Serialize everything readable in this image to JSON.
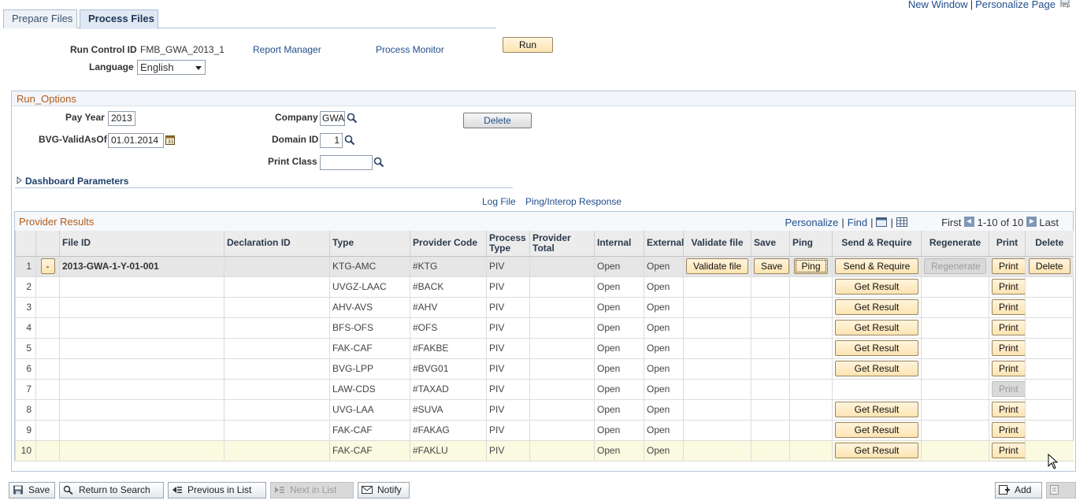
{
  "top_links": {
    "new_window": "New Window",
    "personalize_page": "Personalize Page",
    "separator": "|"
  },
  "tabs": [
    {
      "label": "Prepare Files",
      "active": false
    },
    {
      "label": "Process Files",
      "active": true
    }
  ],
  "header": {
    "run_control_label": "Run Control ID",
    "run_control_value": "FMB_GWA_2013_1",
    "report_manager": "Report Manager",
    "process_monitor": "Process Monitor",
    "run_button": "Run",
    "language_label": "Language",
    "language_value": "English"
  },
  "run_options": {
    "title": "Run_Options",
    "pay_year_label": "Pay Year",
    "pay_year_value": "2013",
    "company_label": "Company",
    "company_value": "GWA",
    "delete_button": "Delete",
    "bvg_label": "BVG-ValidAsOf",
    "bvg_value": "01.01.2014",
    "domain_label": "Domain ID",
    "domain_value": "1",
    "print_class_label": "Print Class",
    "print_class_value": "",
    "dashboard_parameters": "Dashboard Parameters"
  },
  "links": {
    "log_file": "Log File",
    "ping_response": "Ping/Interop Response"
  },
  "grid": {
    "title": "Provider Results",
    "personalize": "Personalize",
    "find": "Find",
    "first": "First",
    "range": "1-10 of 10",
    "last": "Last",
    "columns": {
      "file_id": "File ID",
      "declaration_id": "Declaration ID",
      "type": "Type",
      "provider_code": "Provider Code",
      "process_type_1": "Process",
      "process_type_2": "Type",
      "provider_total_1": "Provider",
      "provider_total_2": "Total",
      "internal": "Internal",
      "external": "External",
      "validate_file": "Validate file",
      "save": "Save",
      "ping": "Ping",
      "send_require": "Send & Require",
      "regenerate": "Regenerate",
      "print": "Print",
      "delete": "Delete"
    },
    "row1": {
      "num": "1",
      "collapse": "-",
      "file_id": "2013-GWA-1-Y-01-001",
      "type": "KTG-AMC",
      "provider_code": "#KTG",
      "process_type": "PIV",
      "internal": "Open",
      "external": "Open",
      "validate_btn": "Validate file",
      "save_btn": "Save",
      "ping_btn": "Ping",
      "send_btn": "Send & Require",
      "regenerate_btn": "Regenerate",
      "print_btn": "Print",
      "delete_btn": "Delete"
    },
    "rows": [
      {
        "num": "2",
        "type": "UVGZ-LAAC",
        "provider_code": "#BACK",
        "process_type": "PIV",
        "internal": "Open",
        "external": "Open",
        "action": "Get Result",
        "print": "Print"
      },
      {
        "num": "3",
        "type": "AHV-AVS",
        "provider_code": "#AHV",
        "process_type": "PIV",
        "internal": "Open",
        "external": "Open",
        "action": "Get Result",
        "print": "Print"
      },
      {
        "num": "4",
        "type": "BFS-OFS",
        "provider_code": "#OFS",
        "process_type": "PIV",
        "internal": "Open",
        "external": "Open",
        "action": "Get Result",
        "print": "Print"
      },
      {
        "num": "5",
        "type": "FAK-CAF",
        "provider_code": "#FAKBE",
        "process_type": "PIV",
        "internal": "Open",
        "external": "Open",
        "action": "Get Result",
        "print": "Print"
      },
      {
        "num": "6",
        "type": "BVG-LPP",
        "provider_code": "#BVG01",
        "process_type": "PIV",
        "internal": "Open",
        "external": "Open",
        "action": "Get Result",
        "print": "Print"
      },
      {
        "num": "7",
        "type": "LAW-CDS",
        "provider_code": "#TAXAD",
        "process_type": "PIV",
        "internal": "Open",
        "external": "Open",
        "action": "",
        "print": "Print"
      },
      {
        "num": "8",
        "type": "UVG-LAA",
        "provider_code": "#SUVA",
        "process_type": "PIV",
        "internal": "Open",
        "external": "Open",
        "action": "Get Result",
        "print": "Print"
      },
      {
        "num": "9",
        "type": "FAK-CAF",
        "provider_code": "#FAKAG",
        "process_type": "PIV",
        "internal": "Open",
        "external": "Open",
        "action": "Get Result",
        "print": "Print"
      },
      {
        "num": "10",
        "type": "FAK-CAF",
        "provider_code": "#FAKLU",
        "process_type": "PIV",
        "internal": "Open",
        "external": "Open",
        "action": "Get Result",
        "print": "Print"
      }
    ]
  },
  "toolbar": {
    "save": "Save",
    "return_to_search": "Return to Search",
    "previous_in_list": "Previous in List",
    "next_in_list": "Next in List",
    "notify": "Notify",
    "add": "Add"
  },
  "colors": {
    "link": "#1f4e8c",
    "section_title": "#b15c1b",
    "button": "#fde4b2",
    "highlight_row": "#fafae0"
  }
}
